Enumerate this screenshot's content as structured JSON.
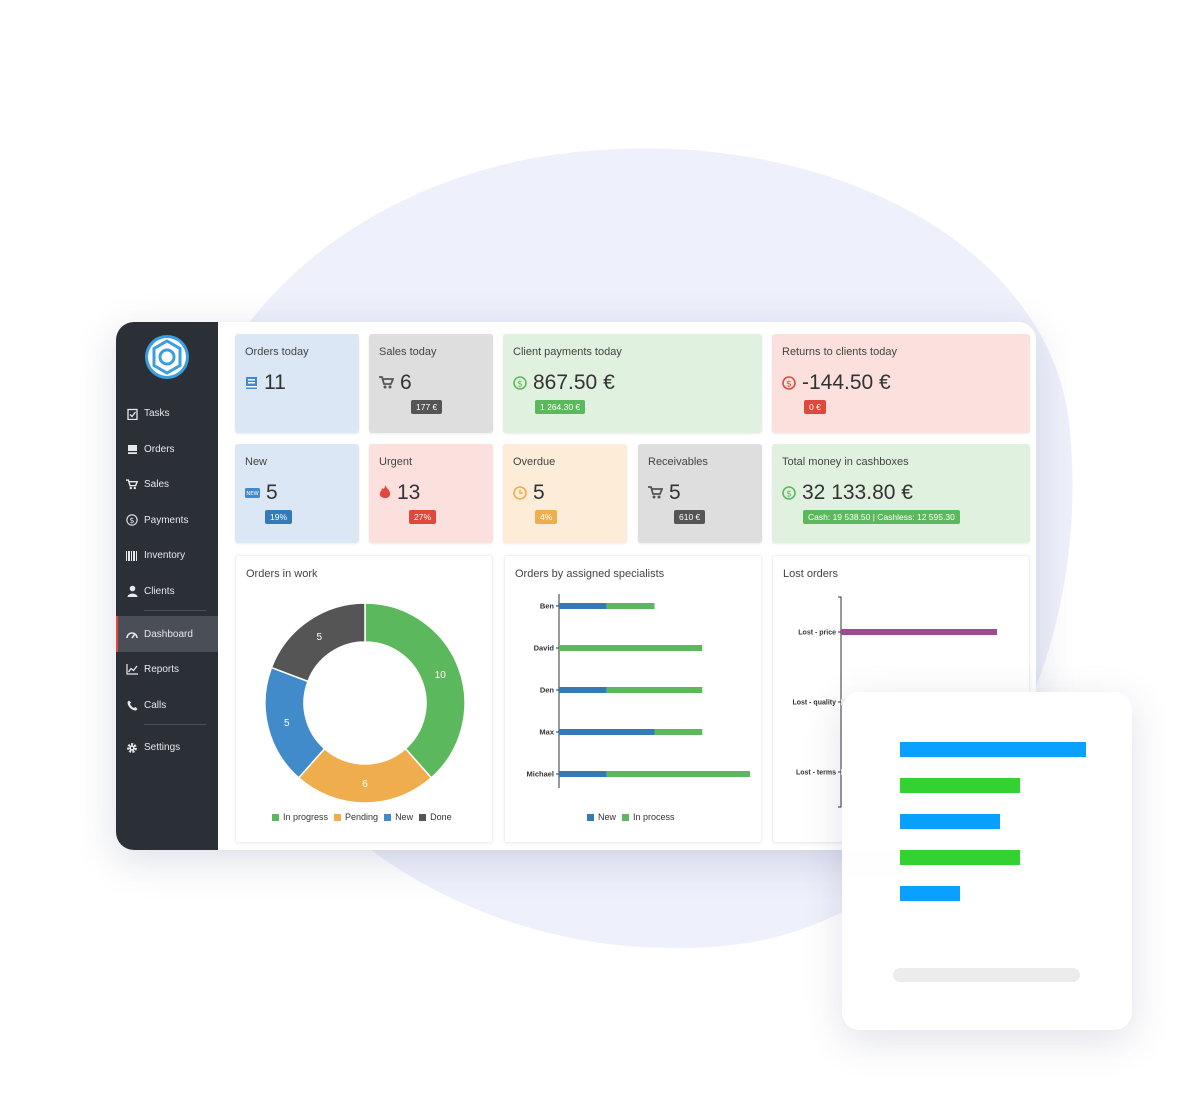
{
  "sidebar": {
    "items": [
      {
        "label": "Tasks",
        "icon": "clipboard-icon"
      },
      {
        "label": "Orders",
        "icon": "inbox-icon"
      },
      {
        "label": "Sales",
        "icon": "cart-icon"
      },
      {
        "label": "Payments",
        "icon": "dollar-circle-icon"
      },
      {
        "label": "Inventory",
        "icon": "barcode-icon"
      },
      {
        "label": "Clients",
        "icon": "user-icon"
      },
      {
        "label": "Dashboard",
        "icon": "gauge-icon"
      },
      {
        "label": "Reports",
        "icon": "line-chart-icon"
      },
      {
        "label": "Calls",
        "icon": "phone-icon"
      },
      {
        "label": "Settings",
        "icon": "gear-icon"
      }
    ],
    "active": "Dashboard"
  },
  "cards": {
    "orders_today": {
      "label": "Orders today",
      "value": "11"
    },
    "sales_today": {
      "label": "Sales today",
      "value": "6",
      "badge": "177 €"
    },
    "client_payments": {
      "label": "Client payments today",
      "value": "867.50 €",
      "badge": "1 264.30 €"
    },
    "returns": {
      "label": "Returns to clients today",
      "value": "-144.50 €",
      "badge": "0 €"
    },
    "new": {
      "label": "New",
      "value": "5",
      "badge": "19%"
    },
    "urgent": {
      "label": "Urgent",
      "value": "13",
      "badge": "27%"
    },
    "overdue": {
      "label": "Overdue",
      "value": "5",
      "badge": "4%"
    },
    "receivables": {
      "label": "Receivables",
      "value": "5",
      "badge": "610 €"
    },
    "cashboxes": {
      "label": "Total money in cashboxes",
      "value": "32 133.80 €",
      "badge": "Cash: 19 538.50 | Cashless: 12 595.30"
    }
  },
  "colors": {
    "green": "#5cb85c",
    "orange": "#f0ad4e",
    "blue": "#428bca",
    "dark": "#555555",
    "red": "#e0483e",
    "purple": "#9b4a93",
    "bar_blue": "#337ab7"
  },
  "orders_in_work": {
    "title": "Orders in work",
    "chart_data": {
      "type": "pie",
      "slices": [
        {
          "name": "In progress",
          "value": 10,
          "color": "#5cb85c"
        },
        {
          "name": "Pending",
          "value": 6,
          "color": "#f0ad4e"
        },
        {
          "name": "New",
          "value": 5,
          "color": "#428bca"
        },
        {
          "name": "Done",
          "value": 5,
          "color": "#555555"
        }
      ]
    }
  },
  "orders_by_specialists": {
    "title": "Orders by assigned specialists",
    "chart_data": {
      "type": "bar",
      "orientation": "horizontal",
      "stacked": true,
      "categories": [
        "Ben",
        "David",
        "Den",
        "Max",
        "Michael"
      ],
      "series": [
        {
          "name": "New",
          "values": [
            2,
            0,
            2,
            4,
            2
          ],
          "color": "#337ab7"
        },
        {
          "name": "In process",
          "values": [
            2,
            6,
            4,
            2,
            6
          ],
          "color": "#5cb85c"
        }
      ],
      "xlim": [
        0,
        8
      ]
    }
  },
  "lost_orders": {
    "title": "Lost orders",
    "chart_data": {
      "type": "bar",
      "orientation": "horizontal",
      "categories": [
        "Lost - price",
        "Lost - quality",
        "Lost - terms"
      ],
      "values": [
        5,
        0,
        0
      ],
      "xlim": [
        0,
        5
      ]
    }
  },
  "overlay": {
    "bars": [
      {
        "value": 0.93,
        "color": "#0aa0ff"
      },
      {
        "value": 0.6,
        "color": "#32d232"
      },
      {
        "value": 0.5,
        "color": "#0aa0ff"
      },
      {
        "value": 0.6,
        "color": "#32d232"
      },
      {
        "value": 0.3,
        "color": "#0aa0ff"
      }
    ]
  }
}
